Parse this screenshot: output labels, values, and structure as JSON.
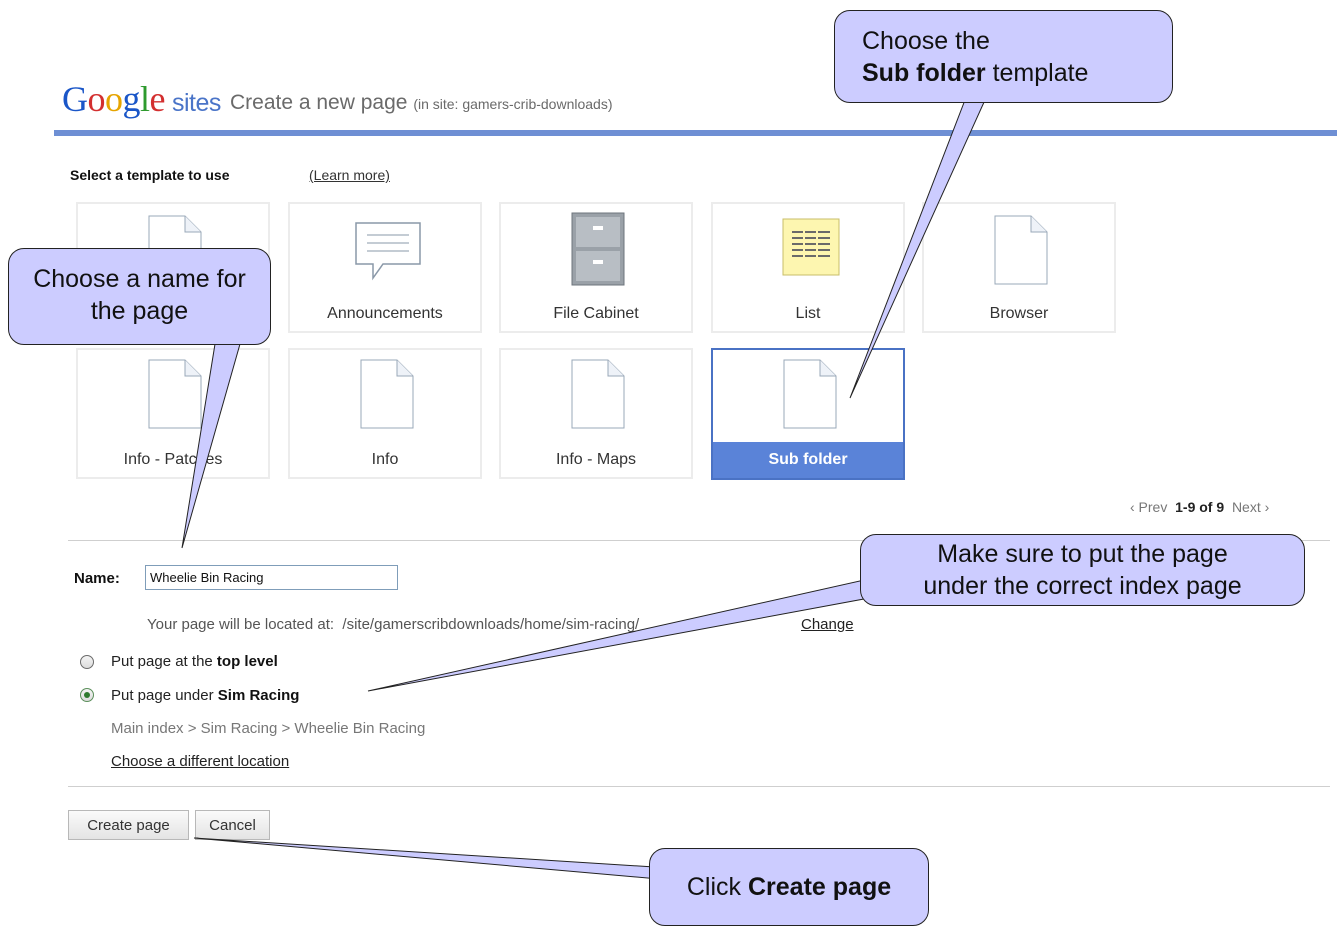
{
  "header": {
    "logo_text": "Google",
    "logo_sites": "sites",
    "title": "Create a new page",
    "site_note": "(in site: gamers-crib-downloads)"
  },
  "templates": {
    "heading": "Select a template to use",
    "learn_more": "(Learn more)",
    "items": [
      {
        "label": "",
        "icon": "document-icon"
      },
      {
        "label": "Announcements",
        "icon": "announcement-icon"
      },
      {
        "label": "File Cabinet",
        "icon": "file-cabinet-icon"
      },
      {
        "label": "List",
        "icon": "list-icon"
      },
      {
        "label": "Browser",
        "icon": "document-icon"
      },
      {
        "label": "Info - Patches",
        "icon": "document-icon"
      },
      {
        "label": "Info",
        "icon": "document-icon"
      },
      {
        "label": "Info - Maps",
        "icon": "document-icon"
      },
      {
        "label": "Sub folder",
        "icon": "document-icon",
        "selected": true
      }
    ],
    "pager": {
      "prev": "‹ Prev",
      "range": "1-9",
      "of": "of",
      "total": "9",
      "next": "Next ›"
    }
  },
  "form": {
    "name_label": "Name:",
    "name_value": "Wheelie Bin Racing",
    "located_prefix": "Your page will be located at:",
    "located_path": "/site/gamerscribdownloads/home/sim-racing/",
    "change_link": "Change",
    "option_top_prefix": "Put page at the",
    "option_top_bold": "top level",
    "option_under_prefix": "Put page under",
    "option_under_bold": "Sim Racing",
    "selected_option": "under",
    "breadcrumb": "Main index > Sim Racing > Wheelie Bin Racing",
    "choose_location": "Choose a different location"
  },
  "buttons": {
    "create": "Create page",
    "cancel": "Cancel"
  },
  "callouts": {
    "name": "Choose a name for the page",
    "template_line1": "Choose the",
    "template_bold": "Sub folder",
    "template_rest": "template",
    "location_line1": "Make sure to put the page",
    "location_line2": "under the correct index page",
    "create_prefix": "Click",
    "create_bold": "Create page"
  },
  "colors": {
    "callout_fill": "#ccccff",
    "accent_rule": "#6e8fd4",
    "selected_tile": "#5a83d8"
  }
}
